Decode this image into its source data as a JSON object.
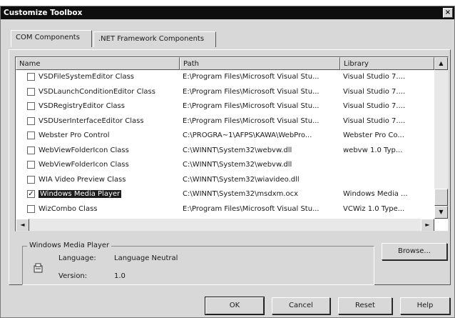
{
  "dialog": {
    "title": "Customize Toolbox",
    "close_glyph": "×"
  },
  "tabs": [
    {
      "label": "COM Components",
      "active": true
    },
    {
      "label": ".NET Framework Components",
      "active": false
    }
  ],
  "table": {
    "columns": [
      "Name",
      "Path",
      "Library"
    ],
    "rows": [
      {
        "checked": false,
        "name": "VSDFileSystemEditor Class",
        "path": "E:\\Program Files\\Microsoft Visual Stu...",
        "library": "Visual Studio 7...."
      },
      {
        "checked": false,
        "name": "VSDLaunchConditionEditor Class",
        "path": "E:\\Program Files\\Microsoft Visual Stu...",
        "library": "Visual Studio 7...."
      },
      {
        "checked": false,
        "name": "VSDRegistryEditor Class",
        "path": "E:\\Program Files\\Microsoft Visual Stu...",
        "library": "Visual Studio 7...."
      },
      {
        "checked": false,
        "name": "VSDUserInterfaceEditor Class",
        "path": "E:\\Program Files\\Microsoft Visual Stu...",
        "library": "Visual Studio 7...."
      },
      {
        "checked": false,
        "name": "Webster Pro Control",
        "path": "C:\\PROGRA~1\\AFPS\\KAWA\\WebPro...",
        "library": "Webster Pro Co..."
      },
      {
        "checked": false,
        "name": "WebViewFolderIcon Class",
        "path": "C:\\WINNT\\System32\\webvw.dll",
        "library": "webvw 1.0 Typ..."
      },
      {
        "checked": false,
        "name": "WebViewFolderIcon Class",
        "path": "C:\\WINNT\\System32\\webvw.dll",
        "library": ""
      },
      {
        "checked": false,
        "name": "WIA Video Preview Class",
        "path": "C:\\WINNT\\System32\\wiavideo.dll",
        "library": ""
      },
      {
        "checked": true,
        "name": "Windows Media Player",
        "path": "C:\\WINNT\\System32\\msdxm.ocx",
        "library": "Windows Media ...",
        "selected": true
      },
      {
        "checked": false,
        "name": "WizCombo Class",
        "path": "E:\\Program Files\\Microsoft Visual Stu...",
        "library": "VCWiz 1.0 Type..."
      }
    ]
  },
  "scroll": {
    "up": "▲",
    "down": "▼",
    "left": "◄",
    "right": "►"
  },
  "details": {
    "group_title": "Windows Media Player",
    "language_label": "Language:",
    "language_value": "Language Neutral",
    "version_label": "Version:",
    "version_value": "1.0",
    "icon": "component-icon"
  },
  "buttons": {
    "browse": "Browse...",
    "ok": "OK",
    "cancel": "Cancel",
    "reset": "Reset",
    "help": "Help"
  }
}
